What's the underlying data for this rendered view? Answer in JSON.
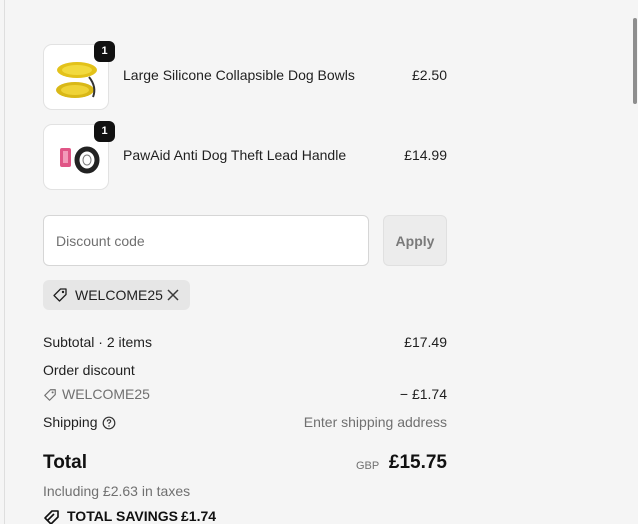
{
  "cart": {
    "items": [
      {
        "name": "Large Silicone Collapsible Dog Bowls",
        "price": "£2.50",
        "quantity": "1"
      },
      {
        "name": "PawAid Anti Dog Theft Lead Handle",
        "price": "£14.99",
        "quantity": "1"
      }
    ]
  },
  "discount": {
    "placeholder": "Discount code",
    "apply_label": "Apply",
    "applied_code": "WELCOME25"
  },
  "summary": {
    "subtotal_label": "Subtotal · 2 items",
    "subtotal_value": "£17.49",
    "order_discount_label": "Order discount",
    "discount_code": "WELCOME25",
    "discount_value": "− £1.74",
    "shipping_label": "Shipping",
    "shipping_value": "Enter shipping address",
    "total_label": "Total",
    "currency": "GBP",
    "total_value": "£15.75",
    "taxes_note": "Including £2.63 in taxes",
    "savings_label": "TOTAL SAVINGS",
    "savings_value": "£1.74"
  },
  "colors": {
    "background": "#f5f5f5",
    "badge": "#111111",
    "chip": "#e6e6e6",
    "muted_text": "#707070"
  },
  "icons": [
    "tag-icon",
    "close-icon",
    "help-circle-icon",
    "savings-tag-icon"
  ]
}
